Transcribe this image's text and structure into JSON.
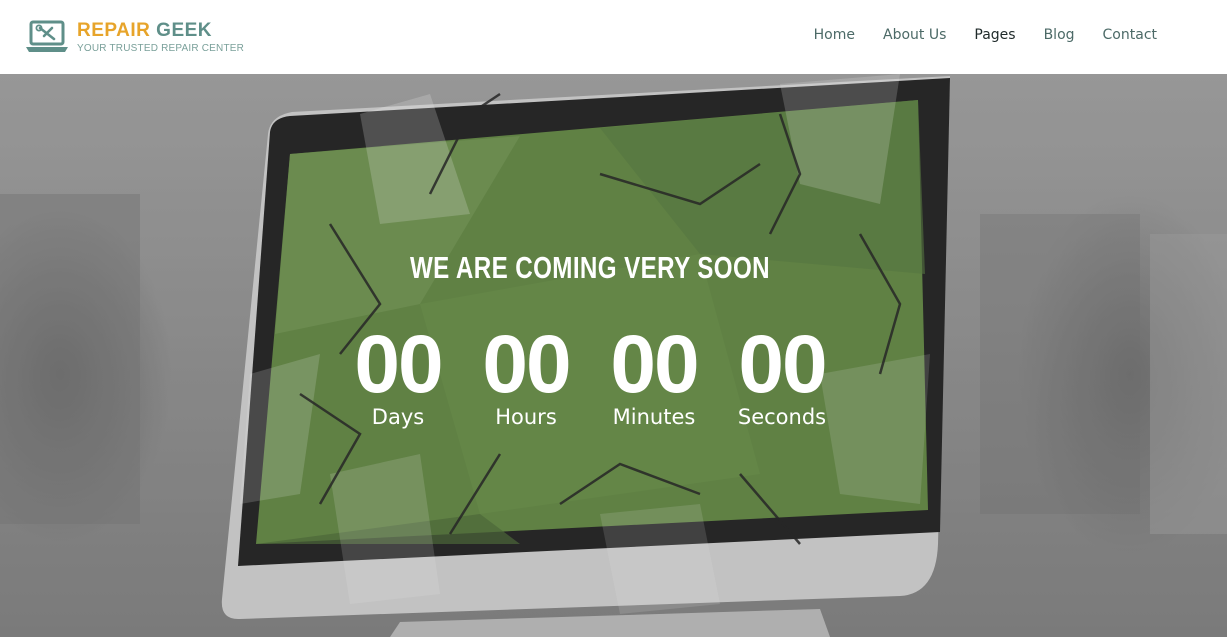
{
  "brand": {
    "name_part1": "REPAIR",
    "name_part2": "GEEK",
    "tagline": "YOUR TRUSTED REPAIR CENTER",
    "colors": {
      "accent": "#e7a42a",
      "secondary": "#5f8f89"
    },
    "icon": "laptop-wrench-icon"
  },
  "nav": {
    "items": [
      {
        "label": "Home"
      },
      {
        "label": "About Us"
      },
      {
        "label": "Pages",
        "active": true
      },
      {
        "label": "Blog"
      },
      {
        "label": "Contact"
      }
    ]
  },
  "hero": {
    "title": "WE ARE COMING VERY SOON",
    "background_image": "broken-monitor-screen",
    "countdown": [
      {
        "value": "00",
        "label": "Days"
      },
      {
        "value": "00",
        "label": "Hours"
      },
      {
        "value": "00",
        "label": "Minutes"
      },
      {
        "value": "00",
        "label": "Seconds"
      }
    ]
  }
}
